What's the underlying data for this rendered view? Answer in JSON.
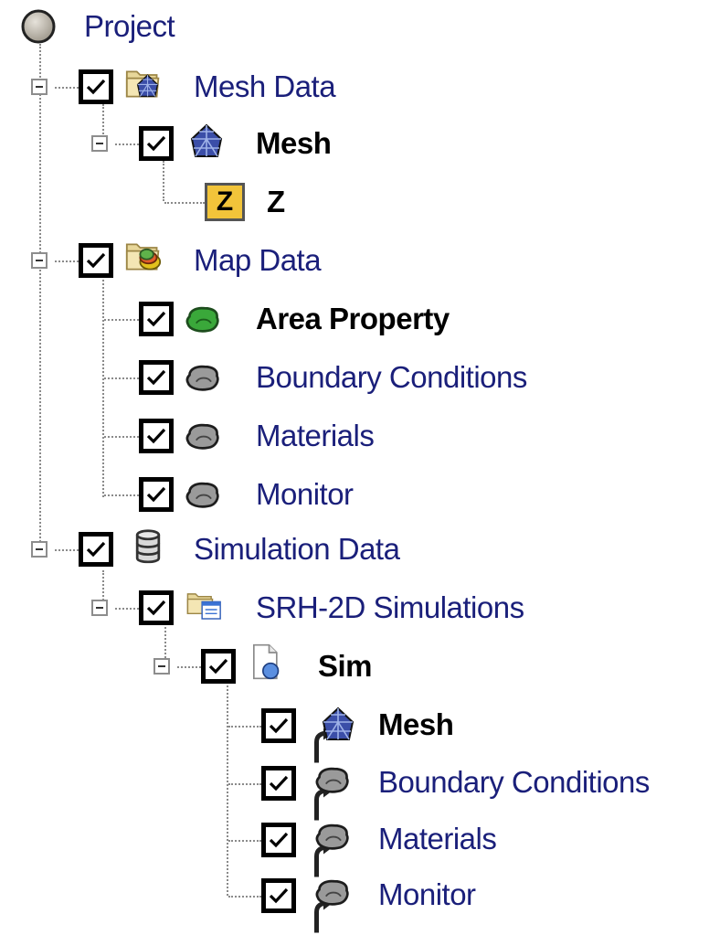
{
  "tree": {
    "root": {
      "label": "Project",
      "icon": "project-node-icon"
    },
    "mesh_data": {
      "label": "Mesh Data",
      "icon": "mesh-folder-icon",
      "mesh": {
        "label": "Mesh",
        "icon": "mesh-icon",
        "z": {
          "label": "Z",
          "icon_letter": "Z",
          "icon": "dataset-z-icon"
        }
      }
    },
    "map_data": {
      "label": "Map Data",
      "icon": "map-folder-icon",
      "items": [
        {
          "label": "Area Property",
          "icon": "coverage-active-icon",
          "checked": true
        },
        {
          "label": "Boundary Conditions",
          "icon": "coverage-icon",
          "checked": true
        },
        {
          "label": "Materials",
          "icon": "coverage-icon",
          "checked": true
        },
        {
          "label": "Monitor",
          "icon": "coverage-icon",
          "checked": true
        }
      ]
    },
    "simulation_data": {
      "label": "Simulation Data",
      "icon": "database-icon",
      "srh": {
        "label": "SRH-2D Simulations",
        "icon": "simulation-folder-icon",
        "sim": {
          "label": "Sim",
          "icon": "simulation-icon",
          "items": [
            {
              "label": "Mesh",
              "icon": "mesh-link-icon",
              "checked": true
            },
            {
              "label": "Boundary Conditions",
              "icon": "coverage-link-icon",
              "checked": true
            },
            {
              "label": "Materials",
              "icon": "coverage-link-icon",
              "checked": true
            },
            {
              "label": "Monitor",
              "icon": "coverage-link-icon",
              "checked": true
            }
          ]
        }
      }
    }
  },
  "colors": {
    "label_blue": "#1a1f7a",
    "connector": "#8a8a8a",
    "active_coverage": "#3aa83a",
    "coverage_gray": "#9a9a9a"
  }
}
